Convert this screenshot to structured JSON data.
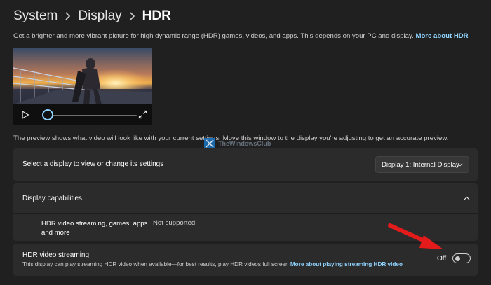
{
  "breadcrumb": {
    "items": [
      "System",
      "Display",
      "HDR"
    ]
  },
  "intro": {
    "text": "Get a brighter and more vibrant picture for high dynamic range (HDR) games, videos, and apps. This depends on your PC and display.",
    "link": "More about HDR"
  },
  "preview": {
    "note": "The preview shows what video will look like with your current settings. Move this window to the display you're adjusting to get an accurate preview.",
    "seek_position": 0.0
  },
  "watermark": {
    "text": "TheWindowsClub"
  },
  "display_select": {
    "label": "Select a display to view or change its settings",
    "selected": "Display 1: Internal Display"
  },
  "capabilities": {
    "header": "Display capabilities",
    "rows": [
      {
        "name": "HDR video streaming, games, apps and more",
        "value": "Not supported"
      }
    ]
  },
  "hdr_streaming": {
    "title": "HDR video streaming",
    "description": "This display can play streaming HDR video when available—for best results, play HDR videos full screen",
    "link": "More about playing streaming HDR video",
    "toggle_state": "Off",
    "toggle_on": false
  },
  "colors": {
    "background": "#202020",
    "card": "#2b2b2b",
    "accent_link": "#8fd3ff",
    "arrow": "#e31b1b"
  },
  "icons": [
    "chevron-right-icon",
    "play-icon",
    "fullscreen-icon",
    "chevron-down-icon",
    "chevron-up-icon",
    "red-arrow-annotation"
  ]
}
